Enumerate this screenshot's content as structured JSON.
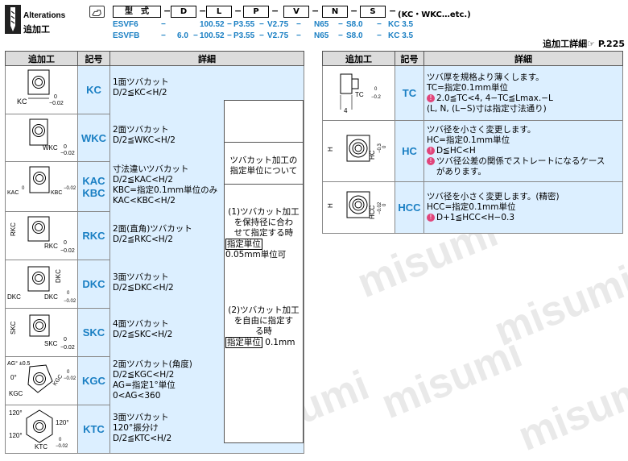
{
  "header": {
    "title_en": "Alterations",
    "title_jp": "追加工",
    "cells": [
      "型　式",
      "D",
      "L",
      "P",
      "V",
      "N",
      "S"
    ],
    "suffix": "(KC・WKC…etc.)",
    "examples": [
      {
        "type": "ESVF6",
        "D": "",
        "L": "100.52",
        "P": "P3.55",
        "V": "V2.75",
        "N": "N65",
        "S": "S8.0",
        "code": "KC 3.5"
      },
      {
        "type": "ESVFB",
        "D": "6.0",
        "L": "100.52",
        "P": "P3.55",
        "V": "V2.75",
        "N": "N65",
        "S": "S8.0",
        "code": "KC 3.5"
      }
    ],
    "reference": "追加工詳細☞ P.225"
  },
  "left_table": {
    "columns": [
      "追加工",
      "記号",
      "詳細"
    ],
    "rows": [
      {
        "code": "KC",
        "detail": [
          "1面ツバカット",
          "D/2≦KC<H/2"
        ],
        "labels": [
          "KC",
          "0",
          "−0.02"
        ]
      },
      {
        "code": "WKC",
        "detail": [
          "2面ツバカット",
          "D/2≦WKC<H/2"
        ],
        "labels": [
          "WKC",
          "0",
          "−0.02"
        ]
      },
      {
        "code": "KAC\nKBC",
        "detail": [
          "寸法違いツバカット",
          "D/2≦KAC<H/2",
          "KBC=指定0.1mm単位のみ",
          "KAC<KBC<H/2"
        ],
        "labels": [
          "KAC",
          "KBC",
          "0",
          "−0.02"
        ]
      },
      {
        "code": "RKC",
        "detail": [
          "2面(直角)ツバカット",
          "D/2≦RKC<H/2"
        ],
        "labels": [
          "RKC",
          "RKC",
          "0",
          "−0.02"
        ]
      },
      {
        "code": "DKC",
        "detail": [
          "3面ツバカット",
          "D/2≦DKC<H/2"
        ],
        "labels": [
          "DKC",
          "DKC",
          "DKC",
          "0",
          "−0.02"
        ]
      },
      {
        "code": "SKC",
        "detail": [
          "4面ツバカット",
          "D/2≦SKC<H/2"
        ],
        "labels": [
          "SKC",
          "SKC",
          "0",
          "−0.02"
        ]
      },
      {
        "code": "KGC",
        "detail": [
          "2面ツバカット(角度)",
          "D/2≦KGC<H/2",
          "AG=指定1°単位",
          "0<AG<360"
        ],
        "labels": [
          "AG° ±0.5",
          "0°",
          "KGC",
          "KGC",
          "0",
          "−0.02"
        ]
      },
      {
        "code": "KTC",
        "detail": [
          "3面ツバカット",
          "120°振分け",
          "D/2≦KTC<H/2"
        ],
        "labels": [
          "120°",
          "120°",
          "120°",
          "KTC",
          "0",
          "−0.02"
        ]
      }
    ],
    "mid_note": {
      "title": [
        "ツバカット加工の",
        "指定単位について"
      ],
      "case1": [
        "(1)ツバカット加工",
        "を保持径に合わ",
        "せて指定する時"
      ],
      "case1_unit_label": "指定単位",
      "case1_unit": "0.05mm単位可",
      "case2": [
        "(2)ツバカット加工",
        "を自由に指定す",
        "る時"
      ],
      "case2_unit_label": "指定単位",
      "case2_unit": " 0.1mm"
    }
  },
  "right_table": {
    "columns": [
      "追加工",
      "記号",
      "詳細"
    ],
    "rows": [
      {
        "code": "TC",
        "detail": [
          "ツバ厚を規格より薄くします。",
          "TC=指定0.1mm単位",
          "2.0≦TC<4, 4−TC≦Lmax.−L",
          "(L, N, (L−S)寸は指定寸法通り)"
        ],
        "marks": [
          false,
          false,
          true,
          false
        ],
        "labels": [
          "TC",
          "0",
          "−0.2",
          "4"
        ]
      },
      {
        "code": "HC",
        "detail": [
          "ツバ径を小さく変更します。",
          "HC=指定0.1mm単位",
          "D≦HC<H",
          "ツバ径公差の関係でストレートになるケース",
          "があります。"
        ],
        "marks": [
          false,
          false,
          true,
          true,
          false
        ],
        "labels": [
          "H",
          "HC",
          "−0.3",
          "0"
        ]
      },
      {
        "code": "HCC",
        "detail": [
          "ツバ径を小さく変更します。(精密)",
          "HCC=指定0.1mm単位",
          "D+1≦HCC<H−0.3"
        ],
        "marks": [
          false,
          false,
          true
        ],
        "labels": [
          "H",
          "HCC",
          "−0.02",
          "0"
        ]
      }
    ]
  },
  "colors": {
    "accent_blue": "#1a7fc3",
    "cell_blue": "#dcefff",
    "header_gray": "#dcdcdc",
    "mark_pink": "#e0457b"
  },
  "watermark": "misumi"
}
